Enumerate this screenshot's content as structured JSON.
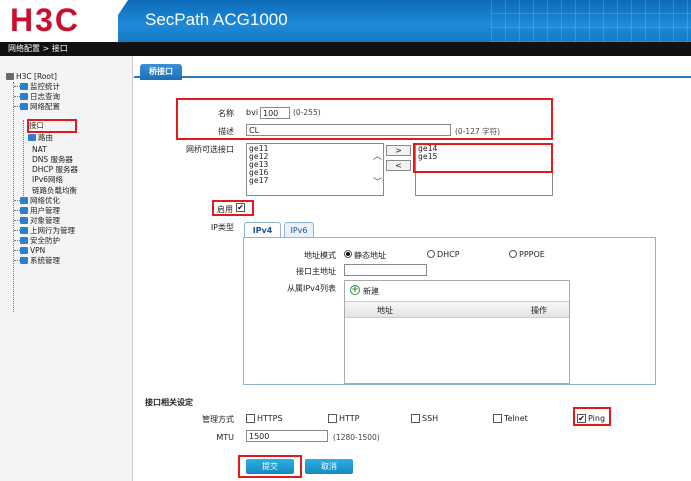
{
  "header": {
    "logo": "H3C",
    "product": "SecPath ACG1000"
  },
  "breadcrumb": "网络配置 > 接口",
  "sidebar": {
    "root": "H3C [Root]",
    "items": [
      {
        "label": "监控统计",
        "icon": "folder-icon"
      },
      {
        "label": "日志查询",
        "icon": "folder-icon"
      },
      {
        "label": "网络配置",
        "icon": "folder-icon"
      },
      {
        "label": "接口",
        "icon": ""
      },
      {
        "label": "路由",
        "icon": "folder-icon"
      },
      {
        "label": "NAT",
        "icon": ""
      },
      {
        "label": "DNS 服务器",
        "icon": ""
      },
      {
        "label": "DHCP 服务器",
        "icon": ""
      },
      {
        "label": "IPv6网络",
        "icon": ""
      },
      {
        "label": "链路负载均衡",
        "icon": ""
      },
      {
        "label": "网络优化",
        "icon": "folder-icon"
      },
      {
        "label": "用户管理",
        "icon": "folder-icon"
      },
      {
        "label": "对象管理",
        "icon": "folder-icon"
      },
      {
        "label": "上网行为管理",
        "icon": "folder-icon"
      },
      {
        "label": "安全防护",
        "icon": "folder-icon"
      },
      {
        "label": "VPN",
        "icon": "folder-icon"
      },
      {
        "label": "系统管理",
        "icon": "folder-icon"
      }
    ]
  },
  "tab": {
    "label": "桥接口"
  },
  "form": {
    "name_label": "名称",
    "name_prefix": "bvi",
    "name_value": "100",
    "name_hint": "(0-255)",
    "desc_label": "描述",
    "desc_value": "CL",
    "desc_hint": "(0-127 字符)",
    "available_label": "网桥可选接口",
    "available": [
      "ge11",
      "ge12",
      "ge13",
      "ge16",
      "ge17"
    ],
    "add_btn": ">",
    "remove_btn": "<",
    "selected": [
      "ge14",
      "ge15"
    ],
    "enable_label": "启用",
    "enable_checked": true,
    "iptype_label": "IP类型",
    "subtabs": [
      "IPv4",
      "IPv6"
    ],
    "addr_mode_label": "地址模式",
    "addr_modes": [
      "静态地址",
      "DHCP",
      "PPPOE"
    ],
    "addr_mode_selected": 0,
    "main_addr_label": "接口主地址",
    "main_addr_value": "",
    "secondary_label": "从属IPv4列表",
    "new_label": "新建",
    "col_addr": "地址",
    "col_op": "操作"
  },
  "iface_settings": {
    "title": "接口相关设定",
    "mgmt_label": "管理方式",
    "methods": [
      {
        "label": "HTTPS",
        "checked": false
      },
      {
        "label": "HTTP",
        "checked": false
      },
      {
        "label": "SSH",
        "checked": false
      },
      {
        "label": "Telnet",
        "checked": false
      },
      {
        "label": "Ping",
        "checked": true
      }
    ],
    "mtu_label": "MTU",
    "mtu_value": "1500",
    "mtu_hint": "(1280-1500)"
  },
  "buttons": {
    "submit": "提交",
    "cancel": "取消"
  },
  "colors": {
    "accent": "#1f7ac4",
    "highlight": "#e11b1b",
    "button": "#1aa3d9"
  }
}
